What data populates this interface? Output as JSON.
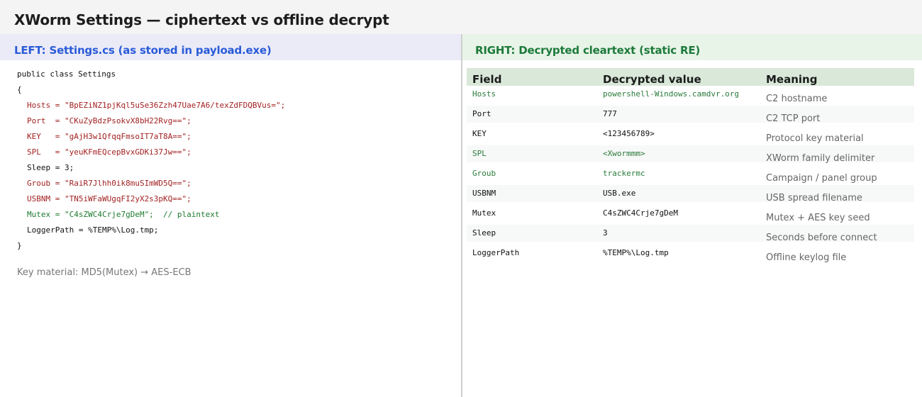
{
  "title": "XWorm Settings — ciphertext vs offline decrypt",
  "left": {
    "heading": "LEFT: Settings.cs (as stored in payload.exe)",
    "code": [
      {
        "text": "public class Settings",
        "style": "plain",
        "indent": false
      },
      {
        "text": "{",
        "style": "plain",
        "indent": false
      },
      {
        "text": "Hosts = \"BpEZiNZ1pjKql5uSe36Zzh47Uae7A6/texZdFDQBVus=\";",
        "style": "red",
        "indent": true
      },
      {
        "text": "Port  = \"CKuZyBdzPsokvX8bH22Rvg==\";",
        "style": "red",
        "indent": true
      },
      {
        "text": "KEY   = \"gAjH3w1QfqqFmsoIT7aT8A==\";",
        "style": "red",
        "indent": true
      },
      {
        "text": "SPL   = \"yeuKFmEQcepBvxGDKi37Jw==\";",
        "style": "red",
        "indent": true
      },
      {
        "text": "Sleep = 3;",
        "style": "plain",
        "indent": true
      },
      {
        "text": "Groub = \"RaiR7Jlhh0ik8muSImWD5Q==\";",
        "style": "red",
        "indent": true
      },
      {
        "text": "USBNM = \"TN5iWFaWUgqFI2yX2s3pKQ==\";",
        "style": "red",
        "indent": true
      },
      {
        "text": "Mutex = \"C4sZWC4Crje7gDeM\";  // plaintext",
        "style": "green",
        "indent": true
      },
      {
        "text": "LoggerPath = %TEMP%\\Log.tmp;",
        "style": "plain",
        "indent": true
      },
      {
        "text": "}",
        "style": "plain",
        "indent": false
      }
    ],
    "note": "Key material: MD5(Mutex) → AES-ECB"
  },
  "right": {
    "heading": "RIGHT: Decrypted cleartext (static RE)",
    "columns": {
      "field": "Field",
      "value": "Decrypted value",
      "meaning": "Meaning"
    },
    "rows": [
      {
        "field": "Hosts",
        "value": "powershell-Windows.camdvr.org",
        "meaning": "C2 hostname",
        "highlight": true
      },
      {
        "field": "Port",
        "value": "777",
        "meaning": "C2 TCP port",
        "highlight": false
      },
      {
        "field": "KEY",
        "value": "<123456789>",
        "meaning": "Protocol key material",
        "highlight": false
      },
      {
        "field": "SPL",
        "value": "<Xwormmm>",
        "meaning": "XWorm family delimiter",
        "highlight": true
      },
      {
        "field": "Groub",
        "value": "trackermc",
        "meaning": "Campaign / panel group",
        "highlight": true
      },
      {
        "field": "USBNM",
        "value": "USB.exe",
        "meaning": "USB spread filename",
        "highlight": false
      },
      {
        "field": "Mutex",
        "value": "C4sZWC4Crje7gDeM",
        "meaning": "Mutex + AES key seed",
        "highlight": false
      },
      {
        "field": "Sleep",
        "value": "3",
        "meaning": "Seconds before connect",
        "highlight": false
      },
      {
        "field": "LoggerPath",
        "value": "%TEMP%\\Log.tmp",
        "meaning": "Offline keylog file",
        "highlight": false
      }
    ]
  },
  "colors": {
    "left_heading": "#2a5bd7",
    "right_heading": "#1d7a3a",
    "ciphertext": "#a32222",
    "plaintext": "#1f7a30"
  }
}
